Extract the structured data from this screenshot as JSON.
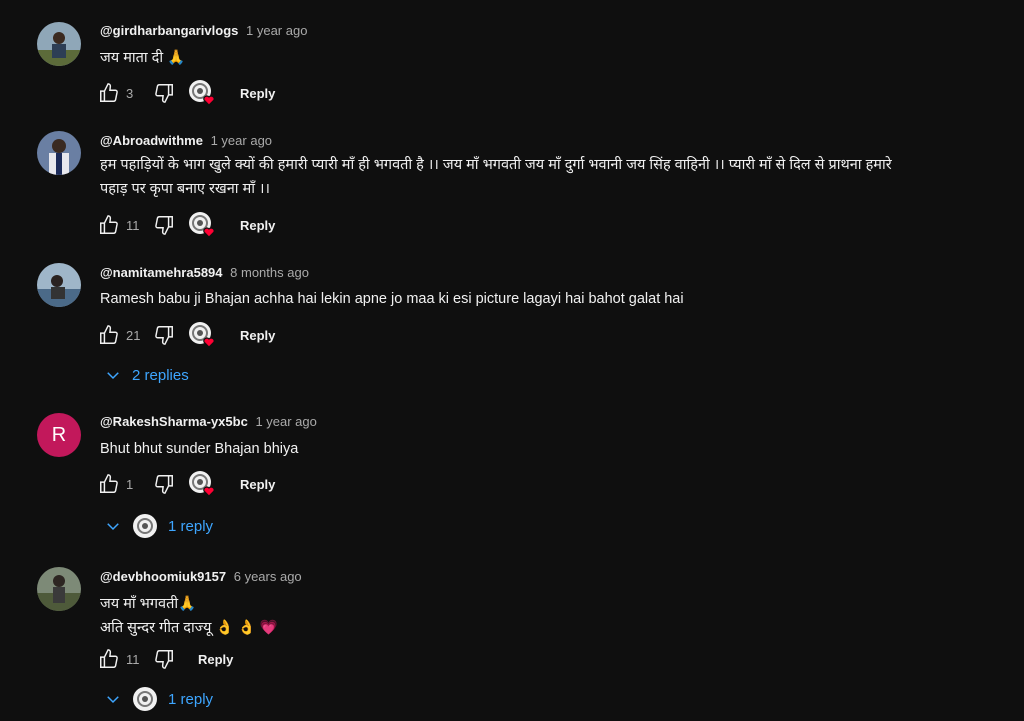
{
  "comments": [
    {
      "author": "@girdharbangarivlogs",
      "time": "1 year ago",
      "lines": [
        "जय माता दी 🙏"
      ],
      "likes": "3",
      "reply_label": "Reply"
    },
    {
      "author": "@Abroadwithme",
      "time": "1 year ago",
      "lines": [
        "हम पहाड़ियों के भाग खुले क्यों की हमारी प्यारी माँ ही भगवती है ।। जय माँ भगवती जय माँ दुर्गा भवानी जय सिंह वाहिनी ।। प्यारी माँ से दिल से प्राथना हमारे",
        "पहाड़ पर कृपा बनाए रखना माँ ।।"
      ],
      "likes": "11",
      "reply_label": "Reply"
    },
    {
      "author": "@namitamehra5894",
      "time": "8 months ago",
      "lines": [
        "Ramesh babu ji Bhajan achha hai lekin apne jo maa ki esi picture lagayi hai bahot galat hai"
      ],
      "likes": "21",
      "reply_label": "Reply",
      "replies_label": "2 replies"
    },
    {
      "author": "@RakeshSharma-yx5bc",
      "avatar_letter": "R",
      "time": "1 year ago",
      "lines": [
        "Bhut bhut sunder Bhajan bhiya"
      ],
      "likes": "1",
      "reply_label": "Reply",
      "replies_label": "1 reply"
    },
    {
      "author": "@devbhoomiuk9157",
      "time": "6 years ago",
      "lines": [
        "जय माँ भगवती🙏",
        "अति सुन्दर गीत दाज्यू 👌 👌 💗"
      ],
      "likes": "11",
      "reply_label": "Reply",
      "replies_label": "1 reply"
    }
  ],
  "colors": {
    "background": "#0f0f0f",
    "text": "#f1f1f1",
    "muted": "#aaaaaa",
    "link": "#3ea6ff",
    "heart": "#ff0033",
    "avatar_r": "#c2185b"
  }
}
